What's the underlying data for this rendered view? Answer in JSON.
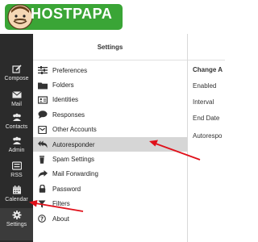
{
  "brand": {
    "logo_text": "HOSTPAPA"
  },
  "sidebar": {
    "items": [
      {
        "label": "Compose",
        "icon": "compose-icon"
      },
      {
        "label": "Mail",
        "icon": "mail-icon"
      },
      {
        "label": "Contacts",
        "icon": "contacts-icon"
      },
      {
        "label": "Admin",
        "icon": "admin-icon"
      },
      {
        "label": "RSS",
        "icon": "rss-icon"
      },
      {
        "label": "Calendar",
        "icon": "calendar-icon"
      },
      {
        "label": "Settings",
        "icon": "gear-icon",
        "active": true
      }
    ]
  },
  "settings": {
    "title": "Settings",
    "menu": [
      {
        "label": "Preferences",
        "icon": "sliders-icon"
      },
      {
        "label": "Folders",
        "icon": "folder-icon"
      },
      {
        "label": "Identities",
        "icon": "id-card-icon"
      },
      {
        "label": "Responses",
        "icon": "chat-icon"
      },
      {
        "label": "Other Accounts",
        "icon": "envelope-square-icon"
      },
      {
        "label": "Autoresponder",
        "icon": "reply-all-icon",
        "selected": true
      },
      {
        "label": "Spam Settings",
        "icon": "trash-icon"
      },
      {
        "label": "Mail Forwarding",
        "icon": "forward-icon"
      },
      {
        "label": "Password",
        "icon": "lock-icon"
      },
      {
        "label": "Filters",
        "icon": "filter-icon"
      },
      {
        "label": "About",
        "icon": "question-circle-icon"
      }
    ]
  },
  "content": {
    "title": "Change A",
    "fields": [
      "Enabled",
      "Interval",
      "End Date",
      "Autorespo"
    ]
  },
  "colors": {
    "sidebar_bg": "#2b2b2b",
    "selected_bg": "#d6d6d6",
    "annotation": "#e0101a",
    "logo_green": "#3aa536"
  }
}
